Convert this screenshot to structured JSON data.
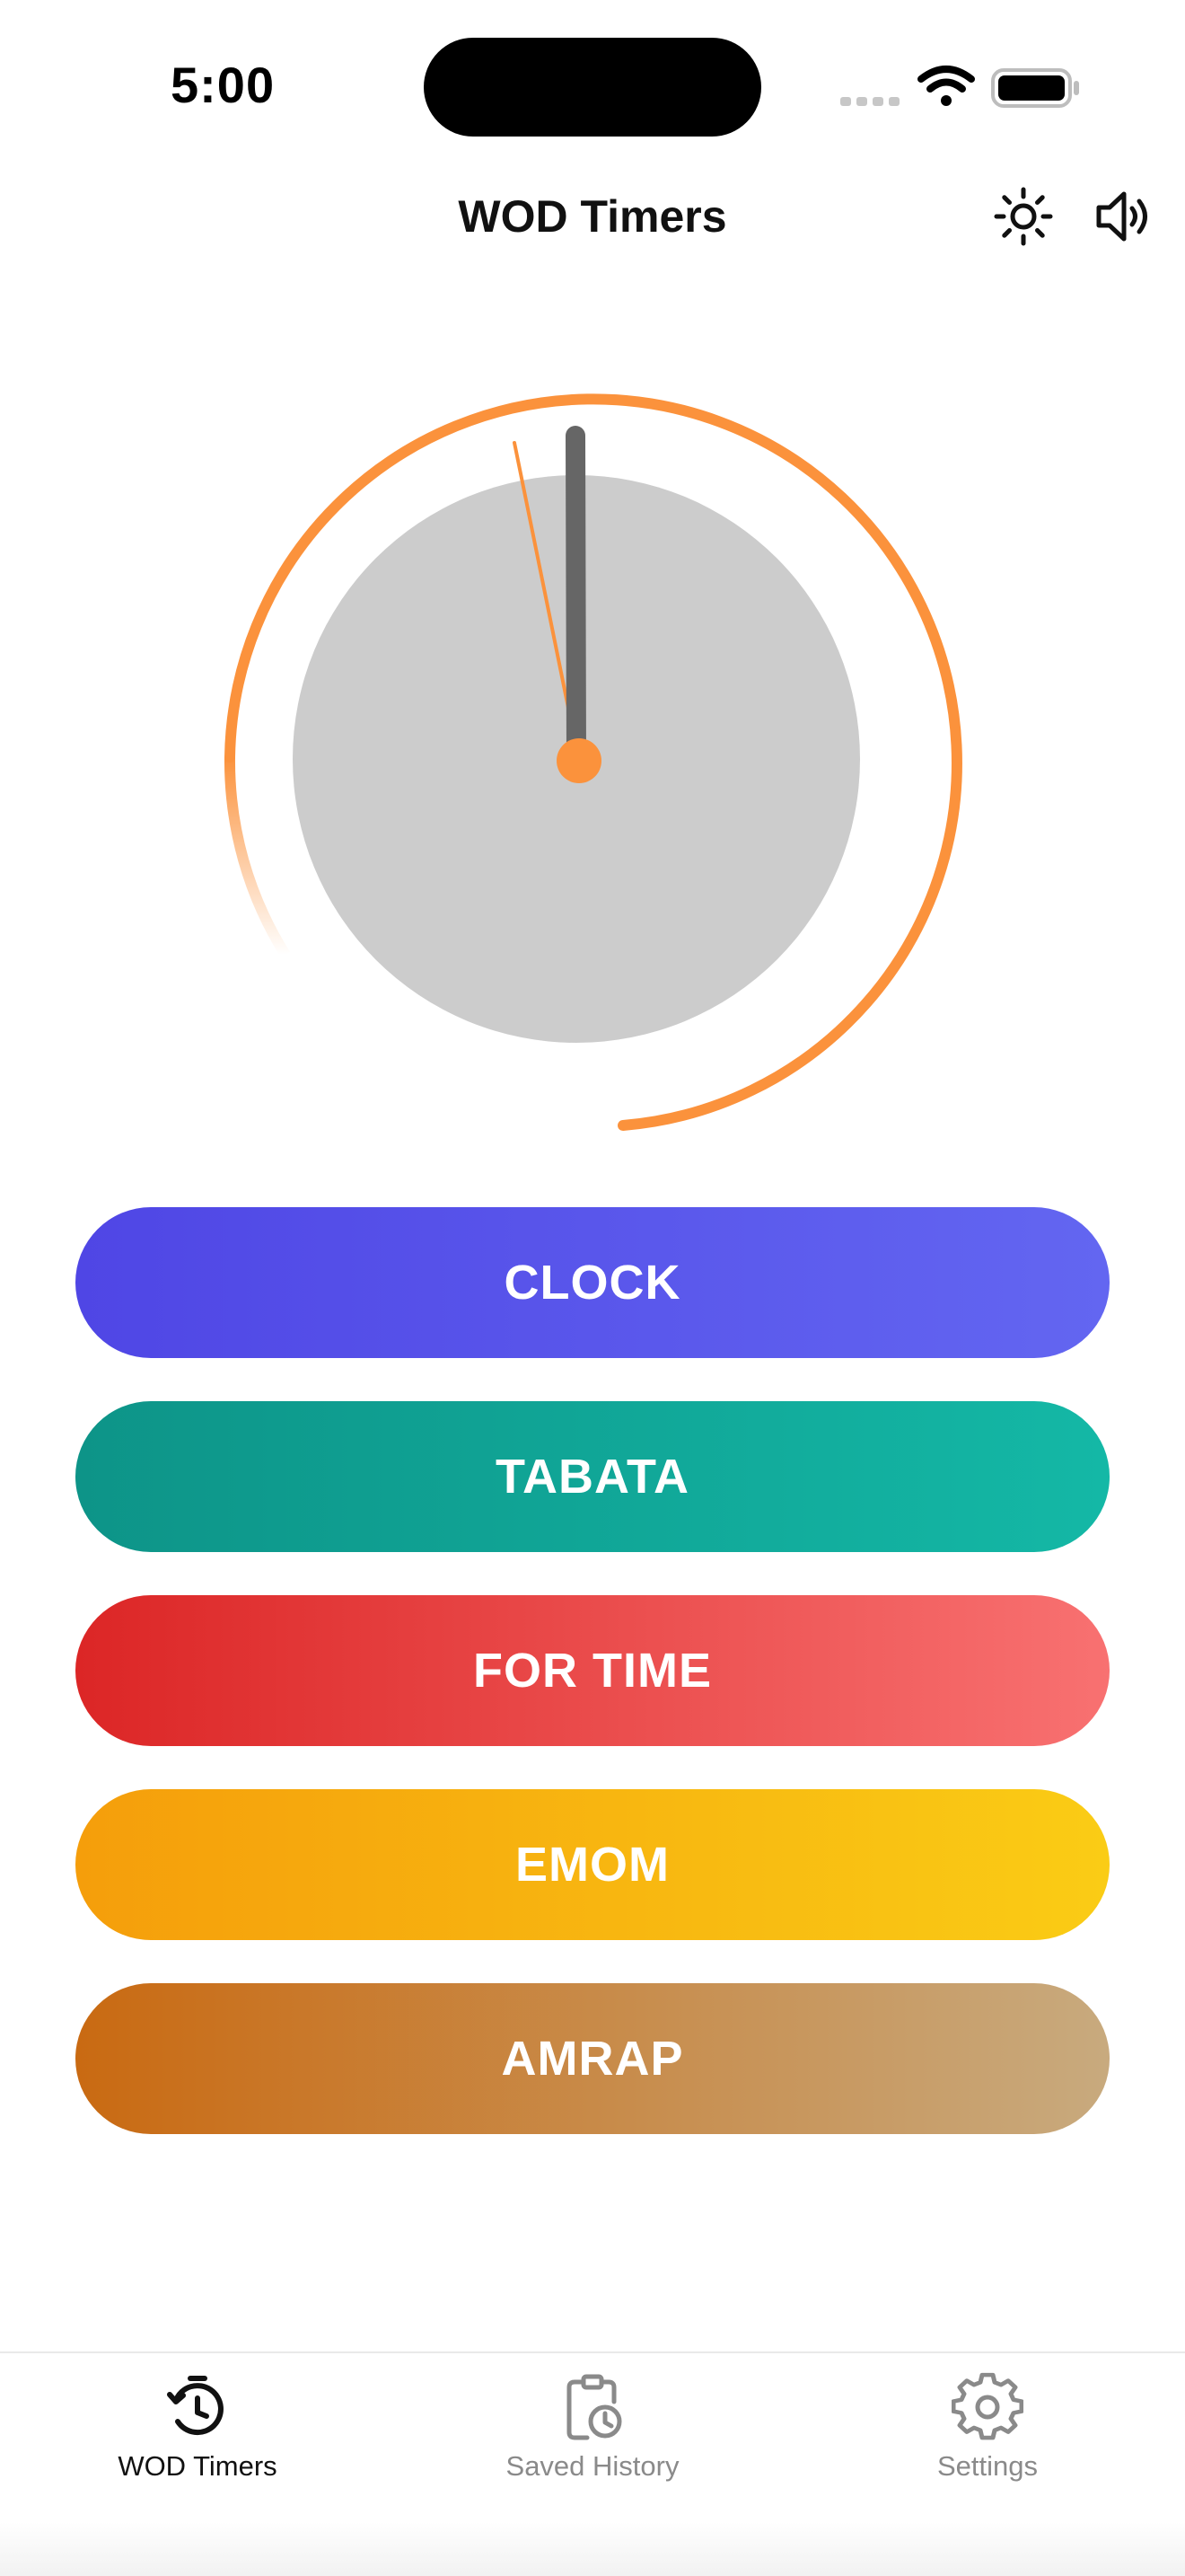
{
  "status_bar": {
    "time": "5:00"
  },
  "nav": {
    "title": "WOD Timers",
    "brightness_icon": "sun-icon",
    "sound_icon": "speaker-icon"
  },
  "clock": {
    "ring_color": "#fb923c",
    "hand_color": "#666666",
    "face_color": "#cccccc"
  },
  "timers": [
    {
      "label": "CLOCK",
      "colors": [
        "#4f46e5",
        "#6366f1"
      ]
    },
    {
      "label": "TABATA",
      "colors": [
        "#0d9488",
        "#14b8a6"
      ]
    },
    {
      "label": "FOR TIME",
      "colors": [
        "#dc2626",
        "#f87171"
      ]
    },
    {
      "label": "EMOM",
      "colors": [
        "#f59e0b",
        "#facc15"
      ]
    },
    {
      "label": "AMRAP",
      "colors": [
        "#c96a12",
        "#c8aa7e"
      ]
    }
  ],
  "tab_bar": {
    "items": [
      {
        "label": "WOD Timers",
        "icon": "timer-icon",
        "active": true
      },
      {
        "label": "Saved History",
        "icon": "clipboard-clock-icon",
        "active": false
      },
      {
        "label": "Settings",
        "icon": "gear-icon",
        "active": false
      }
    ]
  }
}
